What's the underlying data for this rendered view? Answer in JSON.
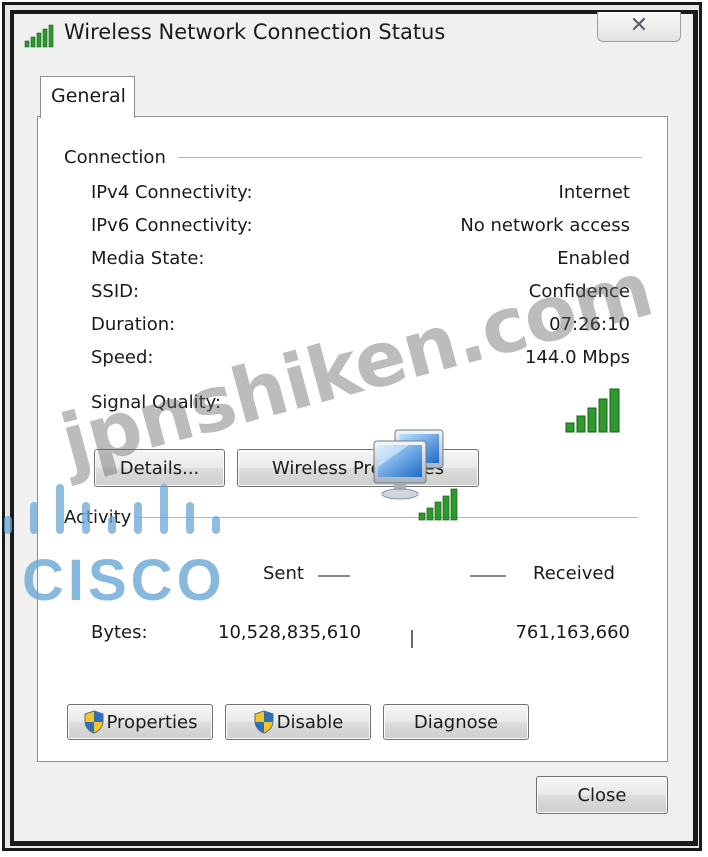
{
  "window": {
    "title": "Wireless Network Connection Status",
    "close_glyph": "✕"
  },
  "tabs": [
    {
      "label": "General"
    }
  ],
  "connection": {
    "heading": "Connection",
    "rows": [
      {
        "label": "IPv4 Connectivity:",
        "value": "Internet"
      },
      {
        "label": "IPv6 Connectivity:",
        "value": "No network access"
      },
      {
        "label": "Media State:",
        "value": "Enabled"
      },
      {
        "label": "SSID:",
        "value": "Confidence"
      },
      {
        "label": "Duration:",
        "value": "07:26:10"
      },
      {
        "label": "Speed:",
        "value": "144.0 Mbps"
      }
    ],
    "signal_label": "Signal Quality:",
    "signal_bars": 5,
    "details_button": "Details...",
    "wireless_properties_button": "Wireless Properties"
  },
  "activity": {
    "heading": "Activity",
    "sent_label": "Sent",
    "received_label": "Received",
    "bytes_label": "Bytes:",
    "bytes_sent": "10,528,835,610",
    "bytes_received": "761,163,660"
  },
  "actions": {
    "properties_button": "Properties",
    "disable_button": "Disable",
    "diagnose_button": "Diagnose"
  },
  "footer": {
    "close_button": "Close"
  },
  "watermark": {
    "text": "jpnshiken.com",
    "logo_text": "CISCO"
  },
  "colors": {
    "signal_green": "#2e9a2e",
    "accent_blue": "#2f6fb8",
    "window_bg": "#f0f0f0"
  },
  "icons": [
    "wireless-signal-icon",
    "close-icon",
    "network-computers-icon",
    "uac-shield-icon"
  ]
}
